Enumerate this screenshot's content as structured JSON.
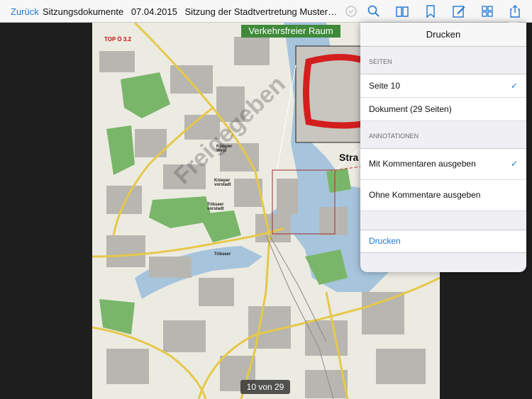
{
  "navbar": {
    "back_label": "Zurück",
    "title_parts": [
      "Sitzungsdokumente",
      "07.04.2015",
      "Sitzung der Stadtvertretung Musterst..."
    ],
    "icons": [
      "sync-icon",
      "search-icon",
      "book-icon",
      "bookmark-icon",
      "edit-icon",
      "grid-icon",
      "share-icon"
    ]
  },
  "document": {
    "topic_label": "TOP Ö 3.2",
    "banner": "Verkehrsfreier Raum",
    "districts": [
      "Knieper West",
      "Knieper vorstadt",
      "Tribseer vorstadt",
      "Tribseer"
    ],
    "city_label": "Stra",
    "watermark": "Freigegeben",
    "page_counter": "10 von 29"
  },
  "print_popover": {
    "title": "Drucken",
    "pages_section": "SEITEN",
    "pages_options": [
      {
        "label": "Seite 10",
        "checked": true
      },
      {
        "label": "Dokument (29 Seiten)",
        "checked": false
      }
    ],
    "annotations_section": "ANNOTATIONEN",
    "annotation_options": [
      {
        "label": "Mit Kommentaren ausgeben",
        "checked": true
      },
      {
        "label": "Ohne Kommentare ausgeben",
        "checked": false
      }
    ],
    "action_label": "Drucken",
    "checkmark": "✓"
  },
  "colors": {
    "accent": "#1e78d6",
    "highlight_red": "#d41e1e",
    "banner_green": "#3e8a3a",
    "water": "#a6c4dc",
    "park": "#7ab66a"
  }
}
